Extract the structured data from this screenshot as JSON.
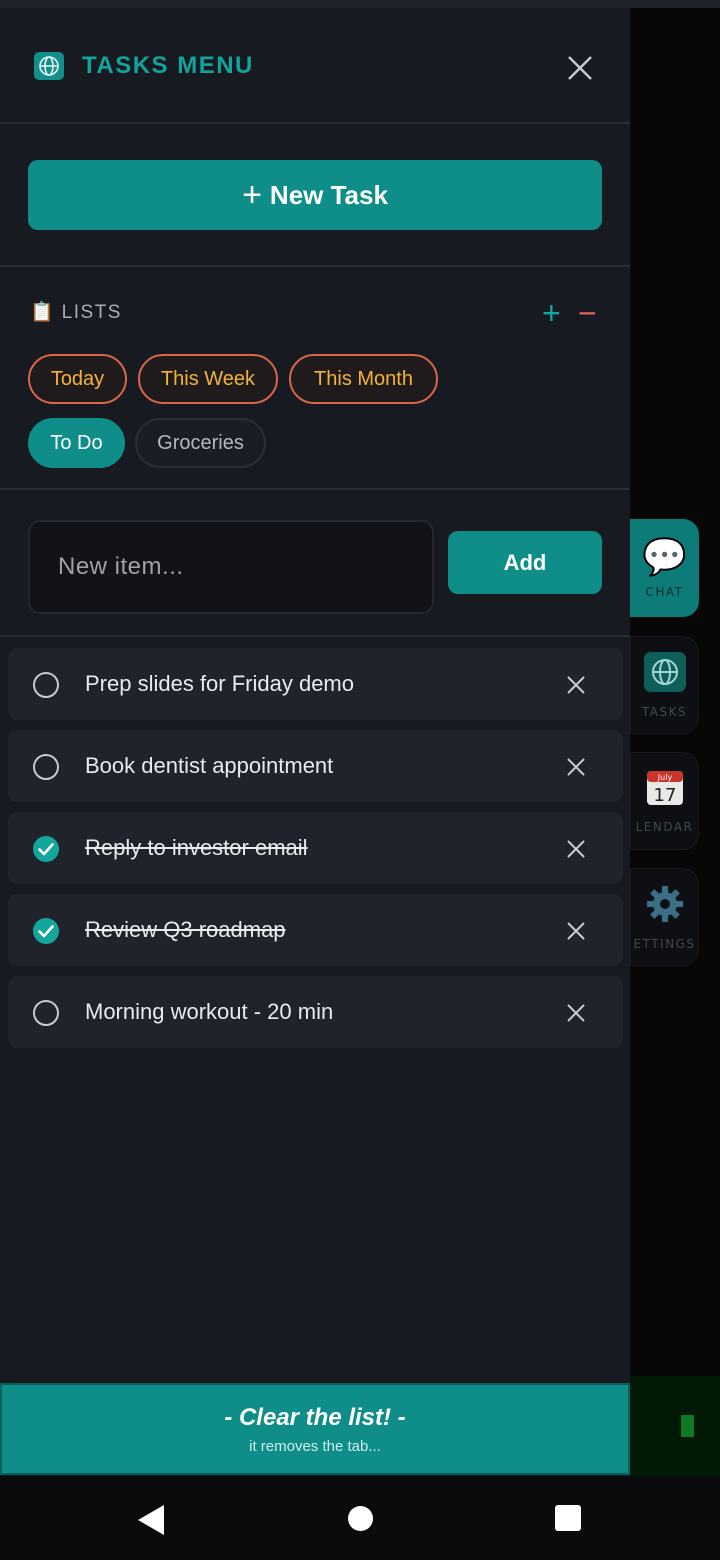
{
  "header": {
    "title": "TASKS MENU",
    "logo_icon": "globe-icon",
    "close_icon": "close-icon"
  },
  "new_task": {
    "label": "New Task",
    "icon": "plus-icon"
  },
  "lists": {
    "label": "LISTS",
    "icon": "clipboard-icon",
    "add_symbol": "+",
    "remove_symbol": "−",
    "chips": [
      {
        "label": "Today",
        "style": "orange"
      },
      {
        "label": "This Week",
        "style": "orange"
      },
      {
        "label": "This Month",
        "style": "orange"
      },
      {
        "label": "To Do",
        "style": "active"
      },
      {
        "label": "Groceries",
        "style": "plain"
      }
    ]
  },
  "new_item": {
    "placeholder": "New item...",
    "value": "",
    "add_label": "Add"
  },
  "items": [
    {
      "text": "Prep slides for Friday demo",
      "done": false
    },
    {
      "text": "Book dentist appointment",
      "done": false
    },
    {
      "text": "Reply to investor email",
      "done": true
    },
    {
      "text": "Review Q3 roadmap",
      "done": true
    },
    {
      "text": "Morning workout - 20 min",
      "done": false
    }
  ],
  "clear": {
    "title": "- Clear the list! -",
    "subtitle": "it removes the tab..."
  },
  "side_rail": [
    {
      "label": "CHAT",
      "icon": "speech-bubble-icon",
      "visible_label": "CHAT"
    },
    {
      "label": "TASKS",
      "icon": "globe-icon",
      "visible_label": "TASKS"
    },
    {
      "label": "CALENDAR",
      "icon": "calendar-icon",
      "visible_label": "LENDAR",
      "calendar_month": "July",
      "calendar_day": "17"
    },
    {
      "label": "SETTINGS",
      "icon": "gear-icon",
      "visible_label": "ETTINGS"
    }
  ],
  "colors": {
    "accent": "#0f8e89",
    "title": "#12a39b",
    "chip_text": "#f3b23b",
    "chip_border": "#d9664a",
    "remove": "#e2654b",
    "drawer_bg": "#181a22",
    "item_bg": "#20222c"
  },
  "nav": {
    "back_icon": "back-triangle-icon",
    "home_icon": "home-circle-icon",
    "recent_icon": "recent-square-icon"
  }
}
